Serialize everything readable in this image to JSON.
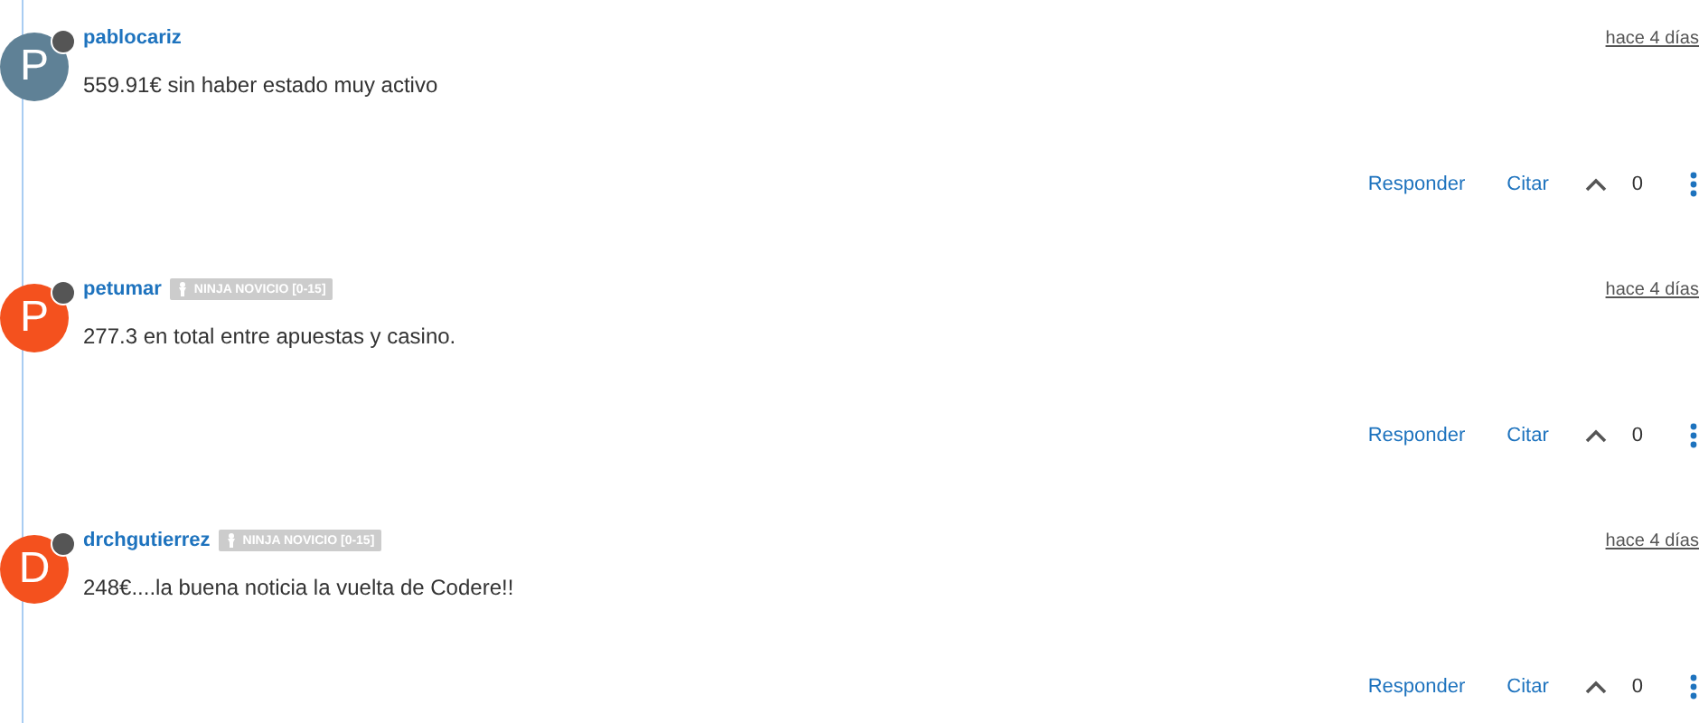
{
  "comments": [
    {
      "avatar": {
        "letter": "P",
        "color": "#5f8196"
      },
      "username": "pablocariz",
      "time": "hace 4 días",
      "text": "559.91€ sin haber estado muy activo",
      "actions": [
        "Responder",
        "Citar"
      ],
      "votes": "0"
    },
    {
      "avatar": {
        "letter": "P",
        "color": "#f4511e"
      },
      "username": "petumar",
      "badge": "NINJA NOVICIO [0-15]",
      "time": "hace 4 días",
      "text": "277.3 en total entre apuestas y casino.",
      "actions": [
        "Responder",
        "Citar"
      ],
      "votes": "0"
    },
    {
      "avatar": {
        "letter": "D",
        "color": "#f4511e"
      },
      "username": "drchgutierrez",
      "badge": "NINJA NOVICIO [0-15]",
      "time": "hace 4 días",
      "text": "248€....la buena noticia la vuelta de Codere!!",
      "actions": [
        "Responder",
        "Citar"
      ],
      "votes": "0"
    }
  ]
}
